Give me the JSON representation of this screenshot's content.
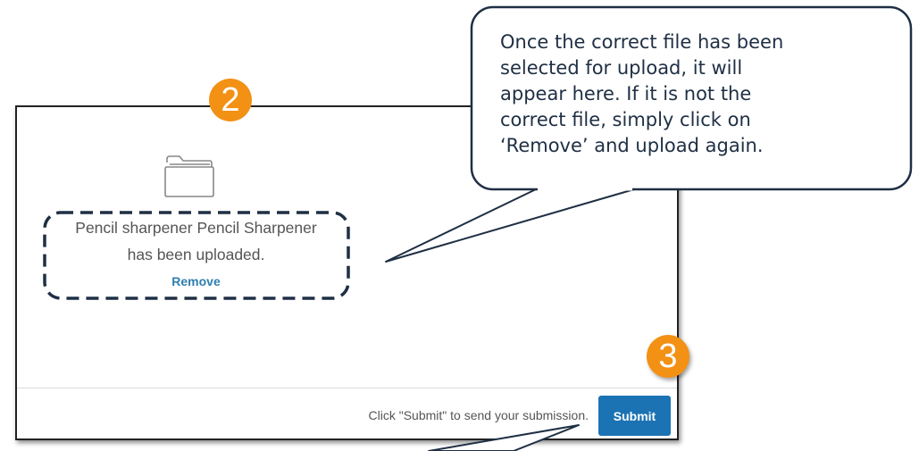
{
  "upload": {
    "file_line1": "Pencil sharpener Pencil Sharpener",
    "file_line2": "has been uploaded.",
    "remove_label": "Remove"
  },
  "footer": {
    "hint": "Click \"Submit\" to send your submission.",
    "submit_label": "Submit"
  },
  "steps": {
    "step2": "2",
    "step3": "3"
  },
  "callout": {
    "lines": [
      "Once the correct file has been",
      "selected for upload, it will",
      "appear here. If it is not the",
      "correct file, simply click on",
      "‘Remove’ and upload again."
    ]
  },
  "colors": {
    "badge": "#f29114",
    "submit": "#1c73b3",
    "link": "#2e7fb0",
    "callout_border": "#1f2f44"
  },
  "icons": {
    "folder": "folder-icon"
  }
}
